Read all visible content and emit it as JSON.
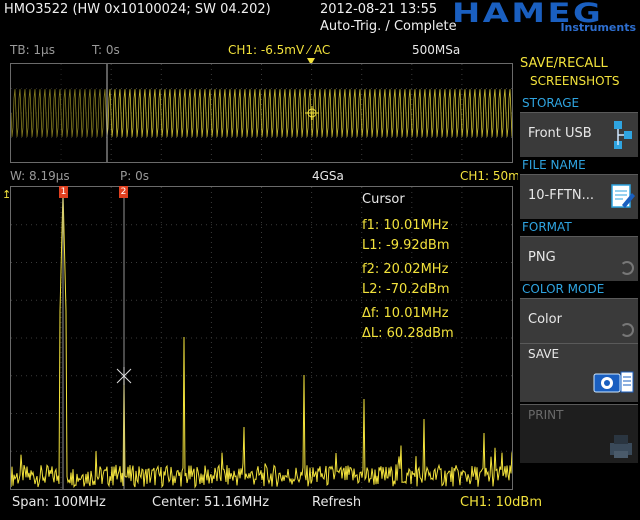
{
  "header": {
    "device": "HMO3522 (HW 0x10100024; SW 04.202)",
    "datetime": "2012-08-21 13:55",
    "status": "Auto-Trig. / Complete",
    "brand": "HAMEG",
    "brand_sub": "Instruments"
  },
  "top_bar": {
    "tb": "TB: 1µs",
    "t": "T: 0s",
    "ch1": "CH1: -6.5mV ⁄ AC",
    "rate": "500MSa"
  },
  "mid_bar": {
    "w": "W: 8.19µs",
    "p": "P: 0s",
    "rate": "4GSa",
    "ch1": "CH1: 50m"
  },
  "cursor": {
    "title": "Cursor",
    "f1": "f1: 10.01MHz",
    "l1": "L1: -9.92dBm",
    "f2": "f2: 20.02MHz",
    "l2": "L2: -70.2dBm",
    "df": "Δf: 10.01MHz",
    "dl": "ΔL: 60.28dBm"
  },
  "markers": {
    "m1": "1",
    "m2": "2"
  },
  "bottom_bar": {
    "span": "Span: 100MHz",
    "center": "Center: 51.16MHz",
    "mode": "Refresh",
    "ch1": "CH1: 10dBm"
  },
  "menu": {
    "title_line1": "SAVE/RECALL",
    "title_line2": "SCREENSHOTS",
    "storage_head": "STORAGE",
    "storage_val": "Front USB",
    "filename_head": "FILE NAME",
    "filename_val": "10-FFTN...",
    "format_head": "FORMAT",
    "format_val": "PNG",
    "color_head": "COLOR MODE",
    "color_val": "Color",
    "save_label": "SAVE",
    "print_label": "PRINT"
  },
  "colors": {
    "trace": "#f2e23c",
    "accent_blue": "#2fa4e0",
    "brand_blue": "#1a5fc0",
    "marker_red": "#e04020"
  },
  "icons": [
    "usb-storage-icon",
    "file-edit-icon",
    "camera-icon",
    "printer-icon",
    "trigger-arrow-icon",
    "crosshair-icon"
  ]
}
